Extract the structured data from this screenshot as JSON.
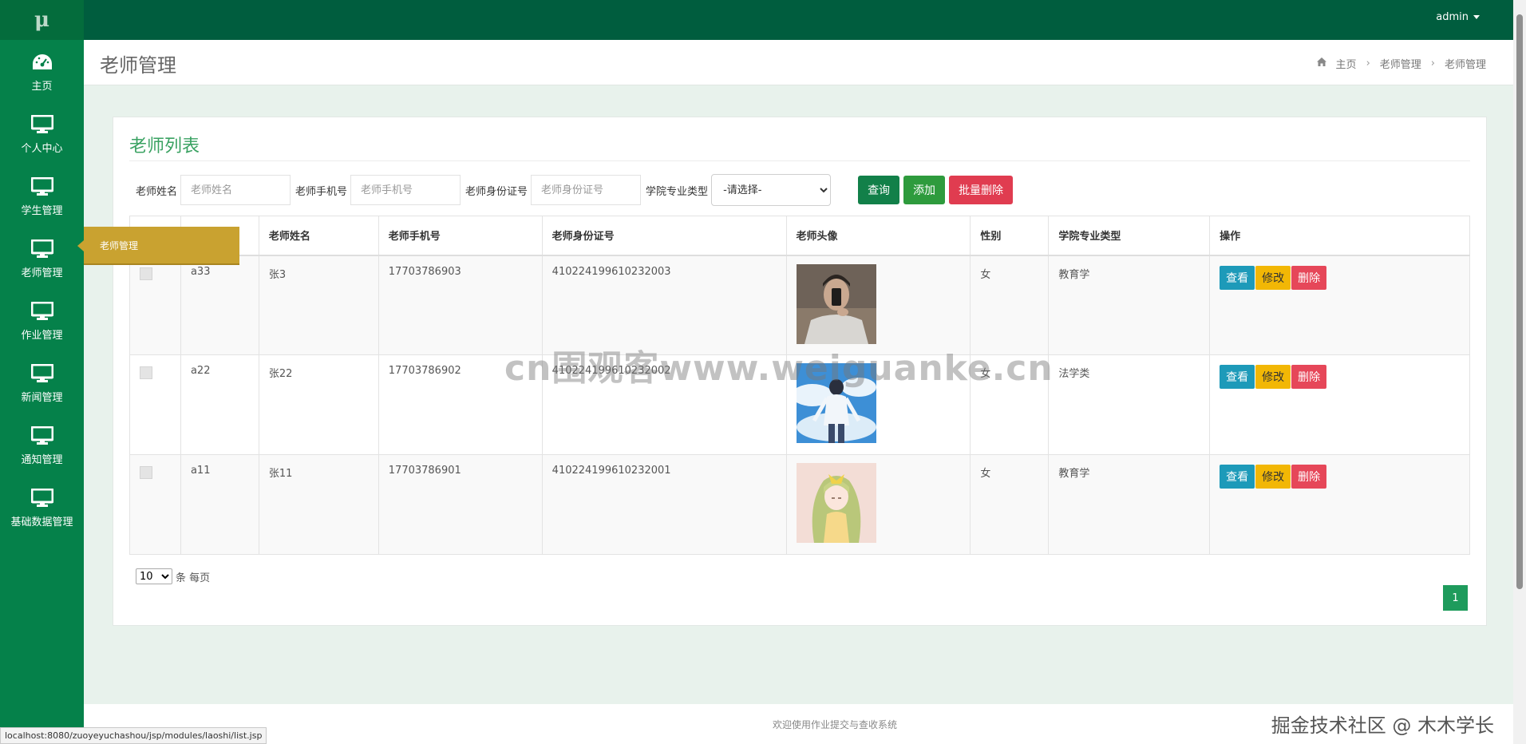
{
  "sidebar": {
    "logo": "μ",
    "items": [
      {
        "label": "主页",
        "icon": "dashboard-icon"
      },
      {
        "label": "个人中心",
        "icon": "monitor-icon"
      },
      {
        "label": "学生管理",
        "icon": "monitor-icon"
      },
      {
        "label": "老师管理",
        "icon": "monitor-icon"
      },
      {
        "label": "作业管理",
        "icon": "monitor-icon"
      },
      {
        "label": "新闻管理",
        "icon": "monitor-icon"
      },
      {
        "label": "通知管理",
        "icon": "monitor-icon"
      },
      {
        "label": "基础数据管理",
        "icon": "monitor-icon"
      }
    ],
    "tooltip": "老师管理"
  },
  "topbar": {
    "user": "admin"
  },
  "header": {
    "title": "老师管理",
    "breadcrumb": [
      "主页",
      "老师管理",
      "老师管理"
    ]
  },
  "panel": {
    "title": "老师列表",
    "search": {
      "name_label": "老师姓名",
      "name_placeholder": "老师姓名",
      "phone_label": "老师手机号",
      "phone_placeholder": "老师手机号",
      "idcard_label": "老师身份证号",
      "idcard_placeholder": "老师身份证号",
      "major_label": "学院专业类型",
      "major_selected": "-请选择-"
    },
    "buttons": {
      "query": "查询",
      "add": "添加",
      "batch_delete": "批量删除"
    },
    "table": {
      "headers": [
        "",
        "",
        "老师姓名",
        "老师手机号",
        "老师身份证号",
        "老师头像",
        "性别",
        "学院专业类型",
        "操作"
      ],
      "rows": [
        {
          "account": "a33",
          "name": "张3",
          "phone": "17703786903",
          "idcard": "410224199610232003",
          "avatar": "avatar-photo-icon",
          "gender": "女",
          "major": "教育学"
        },
        {
          "account": "a22",
          "name": "张22",
          "phone": "17703786902",
          "idcard": "410224199610232002",
          "avatar": "avatar-anime-sky-icon",
          "gender": "女",
          "major": "法学类"
        },
        {
          "account": "a11",
          "name": "张11",
          "phone": "17703786901",
          "idcard": "410224199610232001",
          "avatar": "avatar-anime-girl-icon",
          "gender": "女",
          "major": "教育学"
        }
      ],
      "actions": {
        "view": "查看",
        "edit": "修改",
        "delete": "删除"
      }
    },
    "pager": {
      "size": "10",
      "size_suffix": "条 每页",
      "current_page": "1"
    }
  },
  "footer": {
    "text": "欢迎使用作业提交与查收系统"
  },
  "watermarks": {
    "center": "cn围观客www.weiguanke.cn",
    "corner": "掘金技术社区 @ 木木学长"
  },
  "status_url": "localhost:8080/zuoyeyuchashou/jsp/modules/laoshi/list.jsp",
  "colors": {
    "sidebar": "#05814a",
    "topbar": "#005d3e",
    "accent": "#3aa262",
    "tooltip": "#c9a230"
  }
}
